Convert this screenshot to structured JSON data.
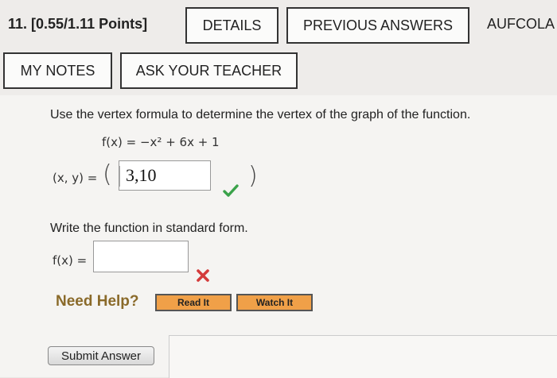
{
  "header": {
    "title": "11.  [0.55/1.11 Points]",
    "details": "DETAILS",
    "previous": "PREVIOUS ANSWERS",
    "cut_off": "AUFCOLA",
    "my_notes": "MY NOTES",
    "ask_teacher": "ASK YOUR TEACHER"
  },
  "part1": {
    "instruction": "Use the vertex formula to determine the vertex of the graph of the function.",
    "function": "f(x) = −x² + 6x + 1",
    "pair_label": "(x, y) =",
    "open_paren": "(",
    "close_paren": ")",
    "answer": "3,10",
    "status": "correct"
  },
  "part2": {
    "instruction": "Write the function in standard form.",
    "label": "f(x) =",
    "value": "",
    "status": "incorrect"
  },
  "help": {
    "label": "Need Help?",
    "read_it": "Read It",
    "watch_it": "Watch It"
  },
  "submit_label": "Submit Answer",
  "colors": {
    "correct": "#3aa24a",
    "incorrect": "#d43b3b",
    "help_text": "#8a6a2a",
    "help_button": "#f0a048"
  }
}
